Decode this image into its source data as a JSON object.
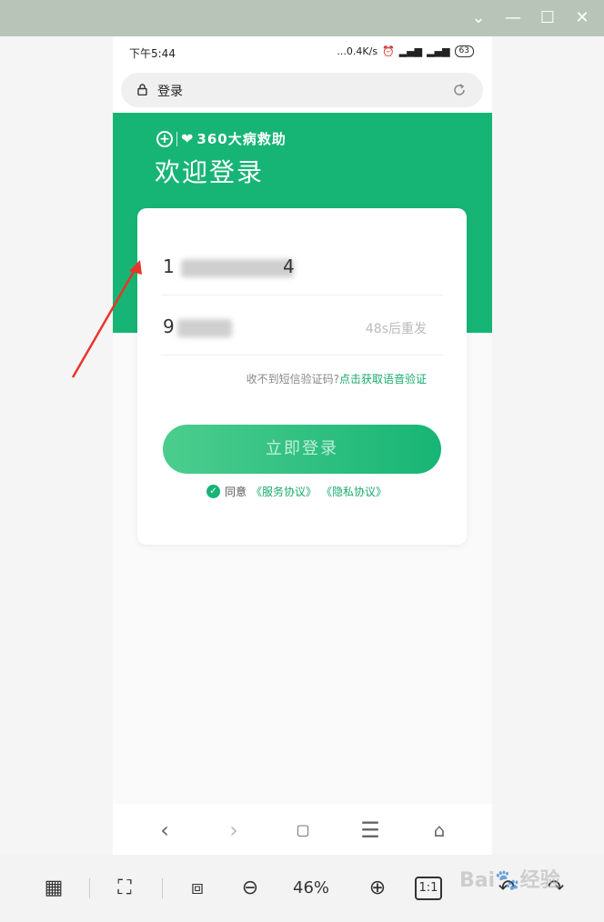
{
  "status_bar": {
    "time": "下午5:44",
    "network_speed": "...0.4K/s",
    "battery": "63"
  },
  "url_bar": {
    "text": "登录"
  },
  "header": {
    "logo_text": "360大病救助",
    "welcome": "欢迎登录"
  },
  "form": {
    "phone_value": "1",
    "phone_value_tail": "4",
    "code_value": "9",
    "resend_text": "48s后重发",
    "hint_prefix": "收不到短信验证码?",
    "hint_link": "点击获取语音验证",
    "login_button": "立即登录",
    "agree_text": "同意",
    "service_agreement": "《服务协议》",
    "privacy_agreement": "《隐私协议》"
  },
  "viewer": {
    "zoom_level": "46%",
    "actual_size_label": "1:1"
  },
  "colors": {
    "brand_green": "#17b575",
    "titlebar": "#b8c4b8",
    "annotation_red": "#e8352b"
  }
}
